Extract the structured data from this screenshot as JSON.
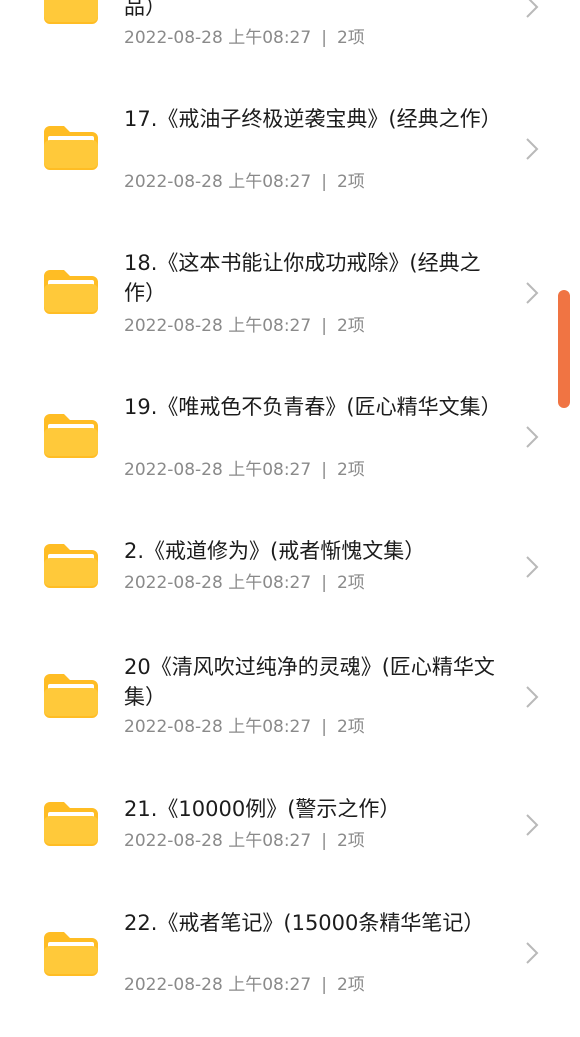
{
  "colors": {
    "folder_body": "#ffc93a",
    "folder_tab": "#ffbd24",
    "folder_paper": "#ffffff",
    "chevron": "#b9b9b9",
    "scrollbar": "#f07443"
  },
  "items": [
    {
      "title": "品）",
      "date": "2022-08-28 上午08:27",
      "count": "2项",
      "icon": "folder-icon"
    },
    {
      "title": "17.《戒油子终极逆袭宝典》(经典之作）",
      "date": "2022-08-28 上午08:27",
      "count": "2项",
      "icon": "folder-icon"
    },
    {
      "title": "18.《这本书能让你成功戒除》(经典之作）",
      "date": "2022-08-28 上午08:27",
      "count": "2项",
      "icon": "folder-icon"
    },
    {
      "title": "19.《唯戒色不负青春》(匠心精华文集）",
      "date": "2022-08-28 上午08:27",
      "count": "2项",
      "icon": "folder-icon"
    },
    {
      "title": "2.《戒道修为》(戒者惭愧文集）",
      "date": "2022-08-28 上午08:27",
      "count": "2项",
      "icon": "folder-icon"
    },
    {
      "title": "20《清风吹过纯净的灵魂》(匠心精华文集）",
      "date": "2022-08-28 上午08:27",
      "count": "2项",
      "icon": "folder-icon"
    },
    {
      "title": "21.《10000例》(警示之作）",
      "date": "2022-08-28 上午08:27",
      "count": "2项",
      "icon": "folder-icon"
    },
    {
      "title": "22.《戒者笔记》(15000条精华笔记）",
      "date": "2022-08-28 上午08:27",
      "count": "2项",
      "icon": "folder-icon"
    }
  ],
  "separator": "|"
}
